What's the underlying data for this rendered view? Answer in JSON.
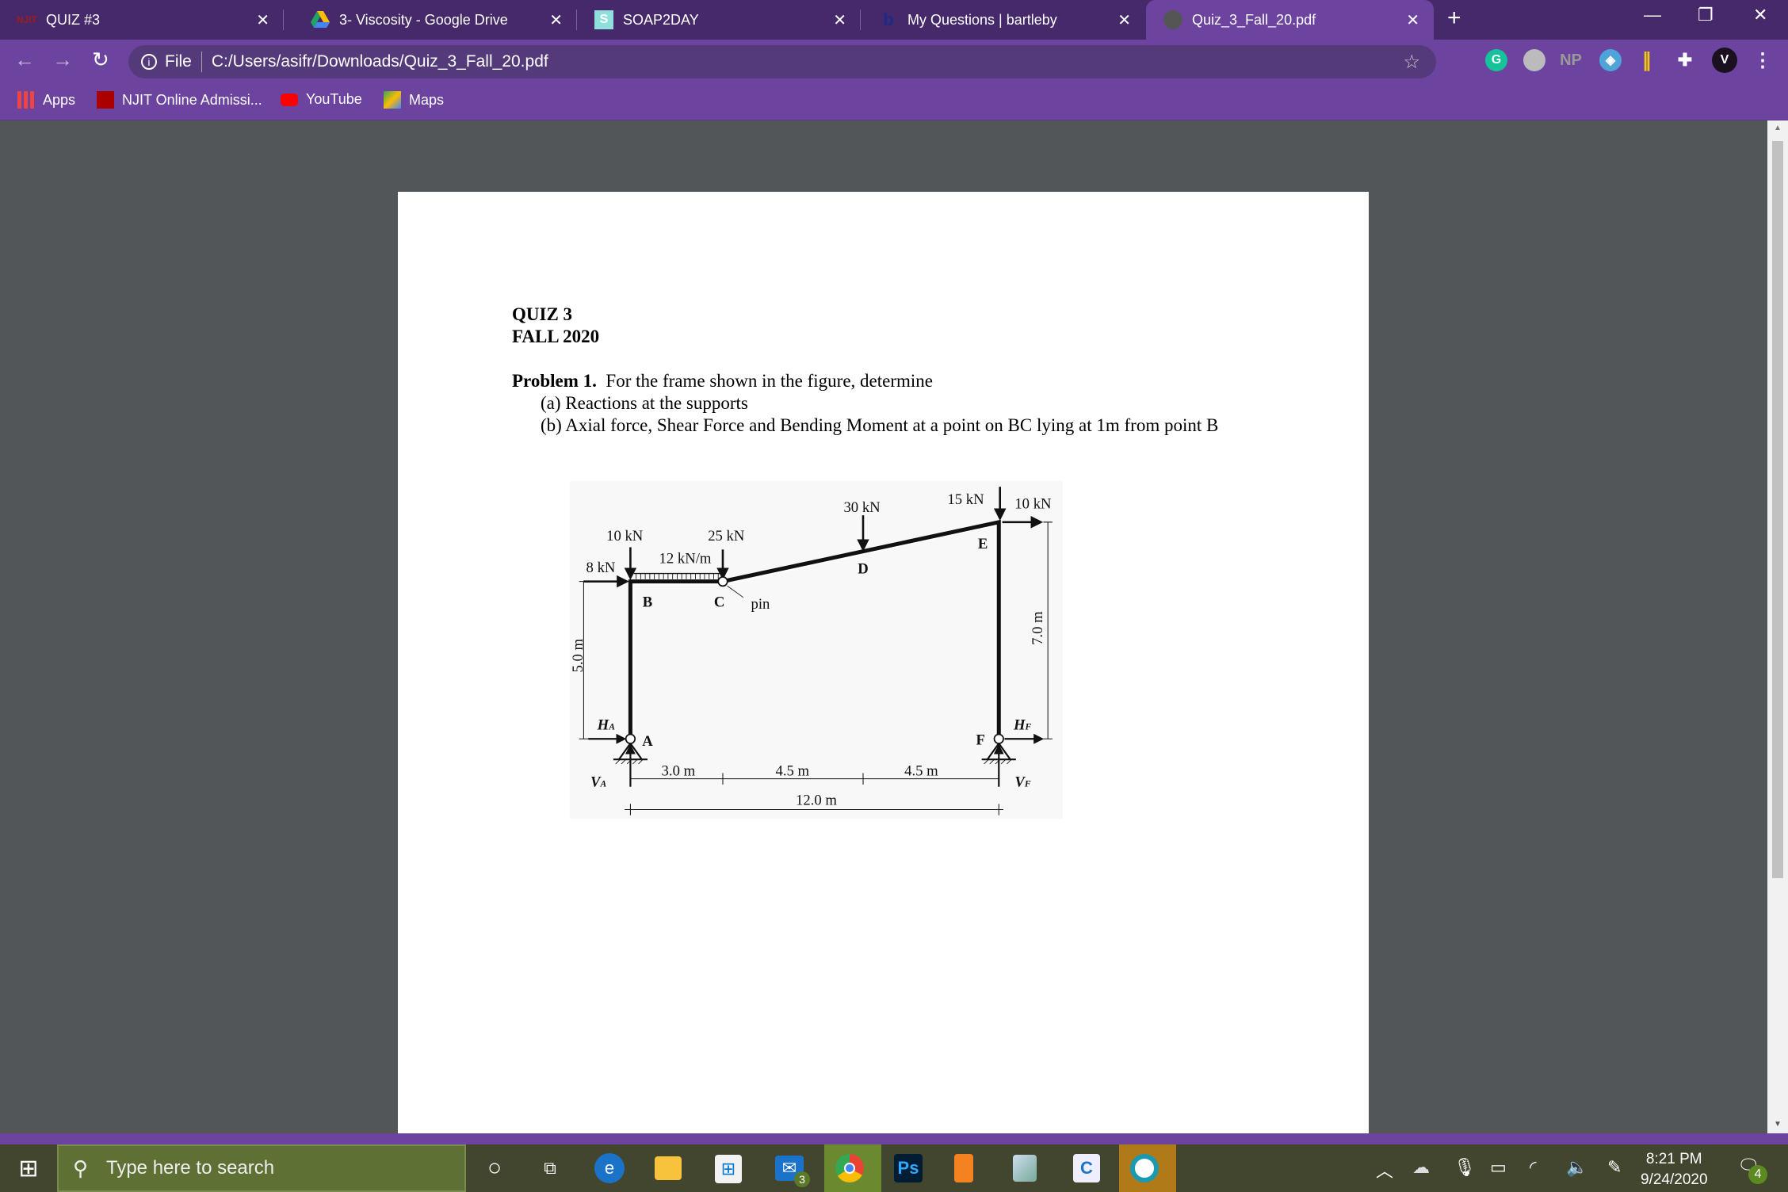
{
  "tabs": [
    {
      "title": "QUIZ #3",
      "icon": "njit-icon"
    },
    {
      "title": "3- Viscosity - Google Drive",
      "icon": "google-drive-icon"
    },
    {
      "title": "SOAP2DAY",
      "icon": "soap2day-icon",
      "icon_text": "S"
    },
    {
      "title": "My Questions | bartleby",
      "icon": "bartleby-icon",
      "icon_text": "b"
    },
    {
      "title": "Quiz_3_Fall_20.pdf",
      "icon": "globe-icon",
      "active": true
    }
  ],
  "toolbar": {
    "scheme": "File",
    "url": "C:/Users/asifr/Downloads/Quiz_3_Fall_20.pdf",
    "ext_np": "NP"
  },
  "bookmarks": [
    {
      "label": "Apps"
    },
    {
      "label": "NJIT Online Admissi..."
    },
    {
      "label": "YouTube"
    },
    {
      "label": "Maps"
    }
  ],
  "document": {
    "title": "QUIZ 3",
    "term": "FALL 2020",
    "problem_label": "Problem 1.",
    "problem_text": "For the frame shown in the figure, determine",
    "part_a": "(a) Reactions at the supports",
    "part_b": "(b) Axial force, Shear Force and Bending Moment at a point on BC lying at 1m from point B"
  },
  "figure": {
    "loads": {
      "f10_left": "10 kN",
      "f25": "25 kN",
      "udl": "12 kN/m",
      "f8": "8 kN",
      "f30": "30 kN",
      "f15": "15 kN",
      "f10_right": "10 kN"
    },
    "points": {
      "A": "A",
      "B": "B",
      "C": "C",
      "D": "D",
      "E": "E",
      "F": "F",
      "pin": "pin"
    },
    "reactions": {
      "HA": "H",
      "HA_sub": "A",
      "HF": "H",
      "HF_sub": "F",
      "VA": "V",
      "VA_sub": "A",
      "VF": "V",
      "VF_sub": "F"
    },
    "dims": {
      "left_h": "5.0 m",
      "right_h": "7.0 m",
      "d1": "3.0 m",
      "d2": "4.5 m",
      "d3": "4.5 m",
      "total": "12.0 m"
    }
  },
  "taskbar": {
    "search_placeholder": "Type here to search",
    "mail_badge": "3",
    "time": "8:21 PM",
    "date": "9/24/2020",
    "notif_count": "4"
  },
  "colors": {
    "tabbar": "#45296a",
    "toolbar": "#6c44a0",
    "viewer_bg": "#525659",
    "taskbar": "#43462f"
  }
}
